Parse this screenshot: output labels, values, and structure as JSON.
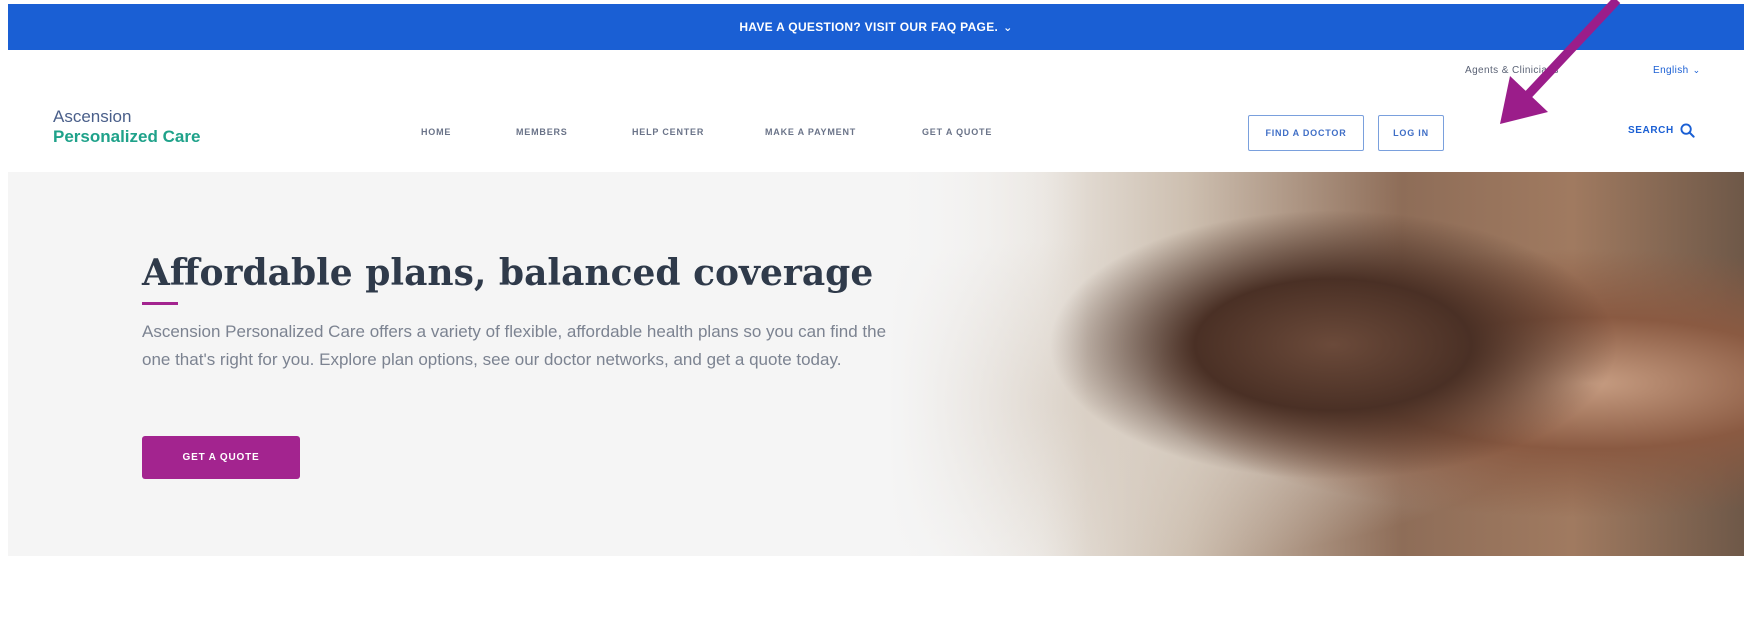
{
  "banner": {
    "text": "HAVE A QUESTION? VISIT OUR FAQ PAGE.",
    "chevron": "⌄"
  },
  "utility": {
    "agents_label": "Agents & Clinicians",
    "language_label": "English",
    "language_chevron": "⌄"
  },
  "logo": {
    "line1": "Ascension",
    "line2": "Personalized Care"
  },
  "nav": {
    "items": [
      {
        "label": "HOME"
      },
      {
        "label": "MEMBERS"
      },
      {
        "label": "HELP CENTER"
      },
      {
        "label": "MAKE A PAYMENT"
      },
      {
        "label": "GET A QUOTE"
      }
    ],
    "find_doctor_label": "FIND A DOCTOR",
    "login_label": "LOG IN",
    "search_label": "SEARCH",
    "search_icon": "magnifier-icon"
  },
  "hero": {
    "title": "Affordable plans, balanced coverage",
    "body": "Ascension Personalized Care offers a variety of flexible, affordable health plans so you can find the one that's right for you. Explore plan options, see our doctor networks, and get a quote today.",
    "cta_label": "GET A QUOTE"
  },
  "colors": {
    "banner_blue": "#1a5fd4",
    "accent_magenta": "#a3248f",
    "logo_teal": "#1fa28a",
    "annotation_arrow": "#9b1d8a"
  }
}
